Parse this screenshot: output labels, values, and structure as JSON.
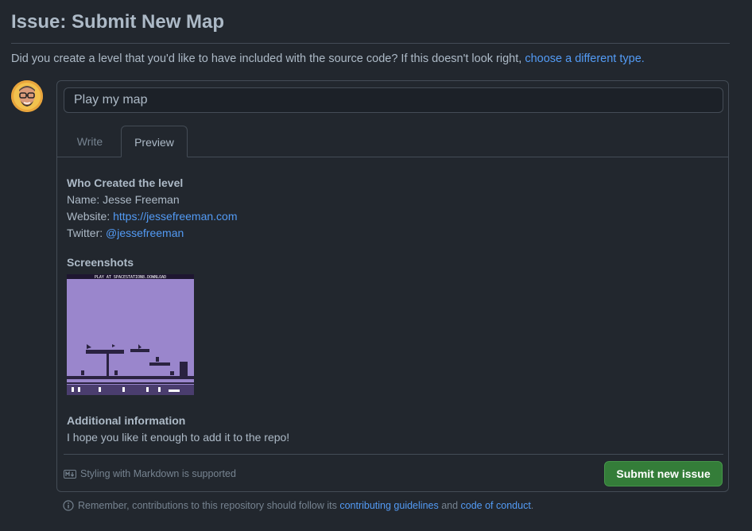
{
  "page": {
    "title": "Issue: Submit New Map",
    "intro_text": "Did you create a level that you'd like to have included with the source code? If this doesn't look right, ",
    "intro_link": "choose a different type."
  },
  "form": {
    "title_value": "Play my map",
    "tabs": [
      {
        "label": "Write",
        "active": false
      },
      {
        "label": "Preview",
        "active": true
      }
    ]
  },
  "preview": {
    "who_heading": "Who Created the level",
    "name_label": "Name: ",
    "name_value": "Jesse Freeman",
    "website_label": "Website: ",
    "website_value": "https://jessefreeman.com",
    "twitter_label": "Twitter: ",
    "twitter_value": "@jessefreeman",
    "screenshots_heading": "Screenshots",
    "screenshot_caption": "PLAY AT SPACESTATION8.DOWNLOAD",
    "additional_heading": "Additional information",
    "additional_text": "I hope you like it enough to add it to the repo!"
  },
  "footer": {
    "markdown_note": "Styling with Markdown is supported",
    "submit_label": "Submit new issue",
    "submit_color": "#347d39"
  },
  "bottom": {
    "prefix": "Remember, contributions to this repository should follow its ",
    "guidelines_link": "contributing guidelines",
    "and_text": " and ",
    "conduct_link": "code of conduct",
    "suffix": "."
  },
  "colors": {
    "background": "#22272e",
    "link": "#539bf5",
    "text": "#adbac7",
    "muted": "#768390",
    "border": "#444c56"
  },
  "icons": [
    "avatar",
    "markdown-icon",
    "info-icon"
  ]
}
